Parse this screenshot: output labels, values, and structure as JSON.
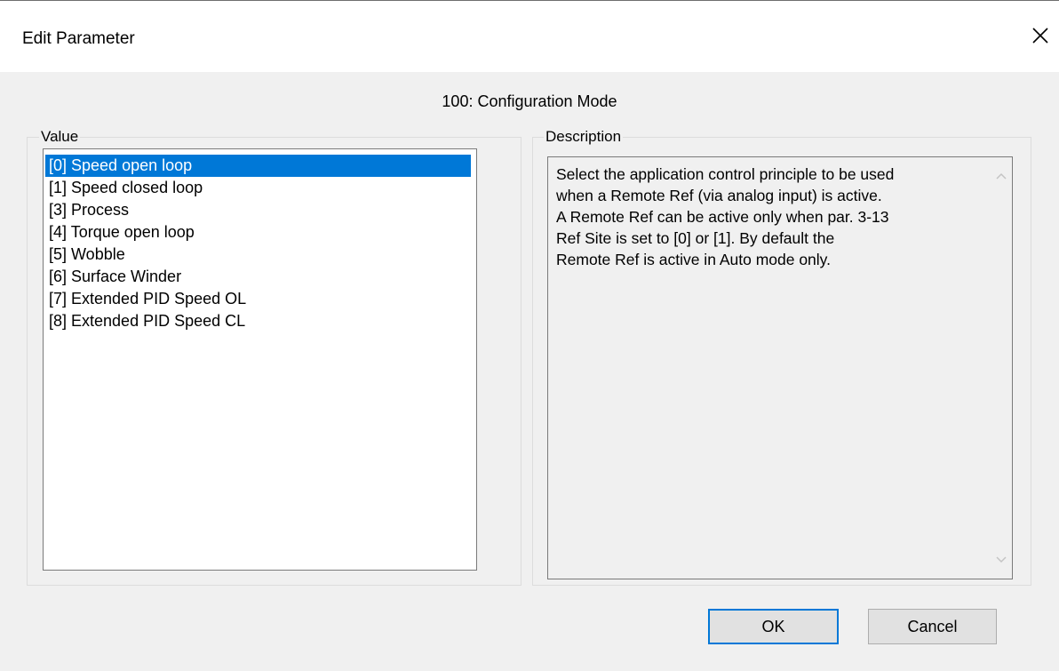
{
  "window": {
    "title": "Edit Parameter",
    "close_icon": "close-icon"
  },
  "parameter": {
    "heading": "100: Configuration Mode"
  },
  "value_group": {
    "label": "Value",
    "selected_index": 0,
    "items": [
      {
        "label": "[0] Speed open loop"
      },
      {
        "label": "[1] Speed closed loop"
      },
      {
        "label": "[3] Process"
      },
      {
        "label": "[4] Torque open loop"
      },
      {
        "label": "[5] Wobble"
      },
      {
        "label": "[6] Surface Winder"
      },
      {
        "label": "[7] Extended PID Speed OL"
      },
      {
        "label": "[8] Extended PID Speed CL"
      }
    ]
  },
  "description_group": {
    "label": "Description",
    "lines": [
      "Select the application control principle to be used",
      "when a Remote Ref (via analog input) is active.",
      "A Remote Ref can be active only when par. 3-13",
      "Ref Site is set to [0] or [1]. By default the",
      "Remote Ref is active in Auto mode only."
    ],
    "scroll_up_icon": "chevron-up-icon",
    "scroll_down_icon": "chevron-down-icon"
  },
  "buttons": {
    "ok_label": "OK",
    "cancel_label": "Cancel"
  },
  "colors": {
    "selection": "#0078d7",
    "dialog_bg": "#f0f0f0",
    "default_button_border": "#0078d7"
  }
}
